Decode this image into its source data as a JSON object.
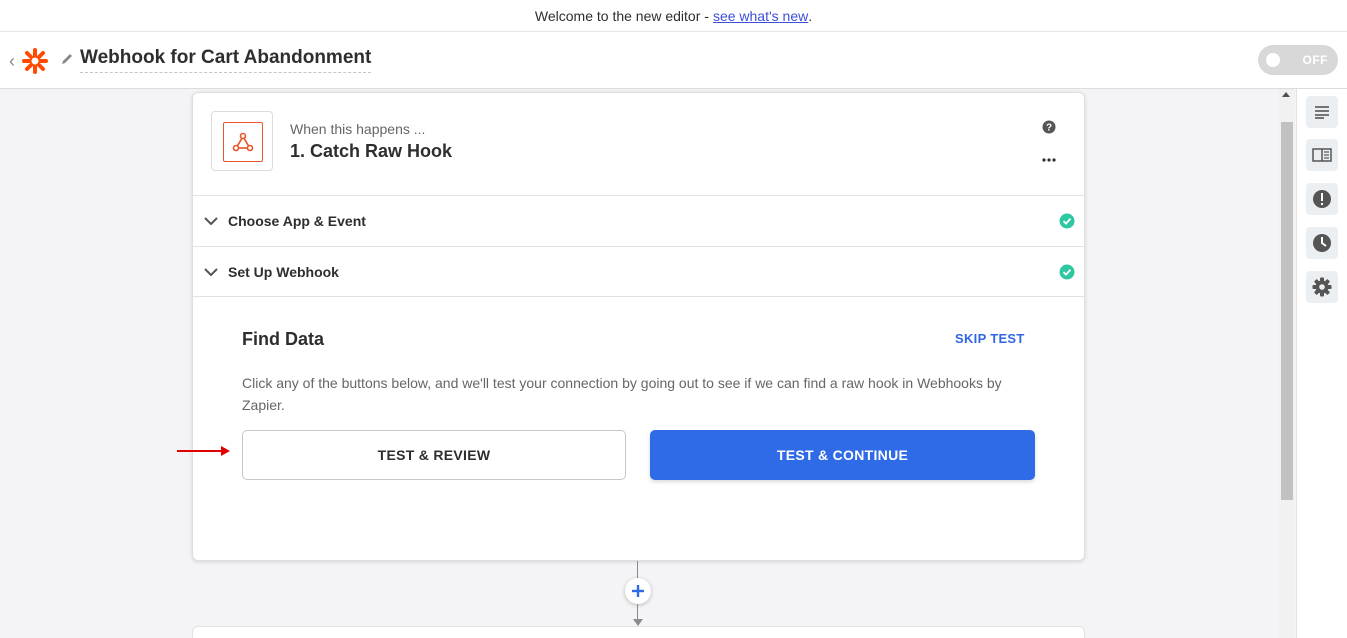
{
  "banner": {
    "text": "Welcome to the new editor -",
    "link": "see what's new",
    "suffix": "."
  },
  "header": {
    "zap_title": "Webhook for Cart Abandonment",
    "toggle_label": "OFF"
  },
  "step": {
    "when_text": "When this happens ...",
    "title": "1. Catch Raw Hook",
    "sections": [
      {
        "label": "Choose App & Event"
      },
      {
        "label": "Set Up Webhook"
      }
    ],
    "find_data": {
      "title": "Find Data",
      "skip_label": "SKIP TEST",
      "description": "Click any of the buttons below, and we'll test your connection by going out to see if we can find a raw hook in Webhooks by Zapier.",
      "review_label": "TEST & REVIEW",
      "continue_label": "TEST & CONTINUE"
    }
  },
  "colors": {
    "brand_orange": "#ff4a00",
    "primary_blue": "#2f6be7",
    "success_green": "#2fc7a1",
    "annotation_red": "#e00000"
  },
  "icons": {
    "rail": [
      "notes-icon",
      "guide-icon",
      "alert-icon",
      "history-icon",
      "settings-icon"
    ]
  }
}
